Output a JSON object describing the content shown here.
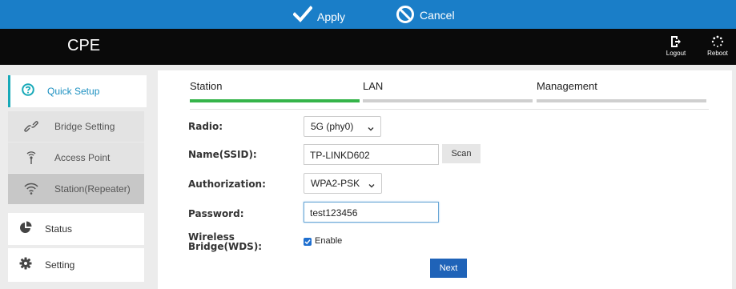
{
  "toolbar": {
    "apply_label": "Apply",
    "cancel_label": "Cancel"
  },
  "header": {
    "brand": "CPE",
    "logout_label": "Logout",
    "reboot_label": "Reboot"
  },
  "sidebar": {
    "items": [
      {
        "label": "Quick Setup",
        "icon": "question-circle-icon"
      },
      {
        "label": "Bridge Setting",
        "icon": "link-icon"
      },
      {
        "label": "Access Point",
        "icon": "access-point-icon"
      },
      {
        "label": "Station(Repeater)",
        "icon": "wifi-icon"
      },
      {
        "label": "Status",
        "icon": "pie-chart-icon"
      },
      {
        "label": "Setting",
        "icon": "gear-icon"
      }
    ]
  },
  "tabs": [
    {
      "label": "Station",
      "active": true
    },
    {
      "label": "LAN",
      "active": false
    },
    {
      "label": "Management",
      "active": false
    }
  ],
  "form": {
    "radio_label": "Radio:",
    "radio_value": "5G (phy0)",
    "ssid_label": "Name(SSID):",
    "ssid_value": "TP-LINKD602",
    "scan_label": "Scan",
    "auth_label": "Authorization:",
    "auth_value": "WPA2-PSK",
    "password_label": "Password:",
    "password_value": "test123456",
    "wds_label_line1": "Wireless",
    "wds_label_line2": "Bridge(WDS):",
    "enable_label": "Enable",
    "enable_checked": true,
    "next_label": "Next"
  },
  "colors": {
    "topbar": "#1a7ec8",
    "accent_tab": "#35b44a",
    "primary_button": "#1f63b8",
    "sidebar_active_border": "#17a9b8"
  }
}
